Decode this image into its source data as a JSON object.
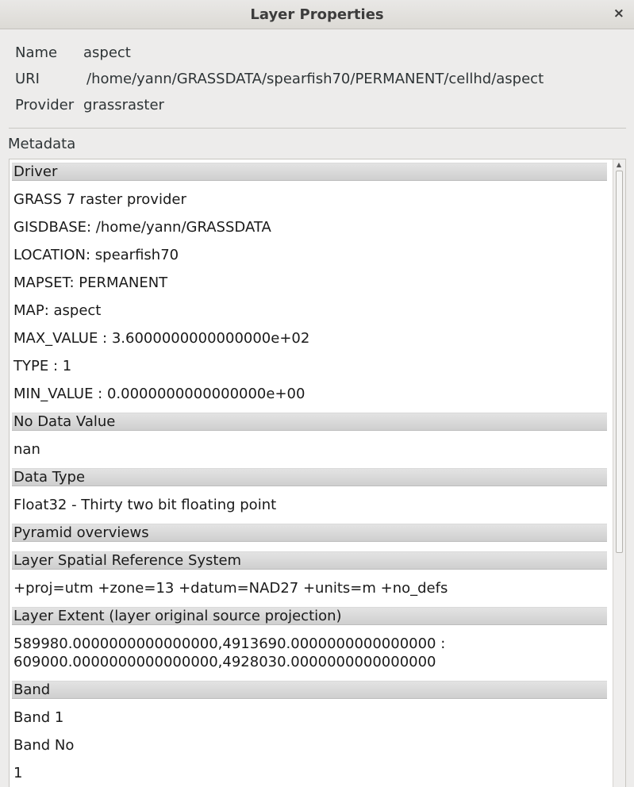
{
  "window": {
    "title": "Layer Properties",
    "close_glyph": "×"
  },
  "info": {
    "name_label": "Name",
    "name_value": "aspect",
    "uri_label": "URI",
    "uri_value": "/home/yann/GRASSDATA/spearfish70/PERMANENT/cellhd/aspect",
    "provider_label": "Provider",
    "provider_value": "grassraster"
  },
  "metadata": {
    "label": "Metadata",
    "rows": [
      {
        "kind": "header",
        "text": "Driver"
      },
      {
        "kind": "value",
        "text": "GRASS 7 raster provider"
      },
      {
        "kind": "value",
        "text": "GISDBASE: /home/yann/GRASSDATA"
      },
      {
        "kind": "value",
        "text": "LOCATION: spearfish70"
      },
      {
        "kind": "value",
        "text": "MAPSET: PERMANENT"
      },
      {
        "kind": "value",
        "text": "MAP: aspect"
      },
      {
        "kind": "value",
        "text": "MAX_VALUE : 3.6000000000000000e+02"
      },
      {
        "kind": "value",
        "text": "TYPE : 1"
      },
      {
        "kind": "value",
        "text": "MIN_VALUE : 0.0000000000000000e+00"
      },
      {
        "kind": "header",
        "text": "No Data Value"
      },
      {
        "kind": "value",
        "text": "nan"
      },
      {
        "kind": "header",
        "text": "Data Type"
      },
      {
        "kind": "value",
        "text": "Float32 - Thirty two bit floating point"
      },
      {
        "kind": "header",
        "text": "Pyramid overviews"
      },
      {
        "kind": "header",
        "text": "Layer Spatial Reference System"
      },
      {
        "kind": "value",
        "text": "+proj=utm +zone=13 +datum=NAD27 +units=m +no_defs"
      },
      {
        "kind": "header",
        "text": "Layer Extent (layer original source projection)"
      },
      {
        "kind": "multi",
        "lines": [
          "589980.0000000000000000,4913690.0000000000000000 :",
          "609000.0000000000000000,4928030.0000000000000000"
        ]
      },
      {
        "kind": "header",
        "text": "Band"
      },
      {
        "kind": "value",
        "text": "Band 1"
      },
      {
        "kind": "value",
        "text": "Band No"
      },
      {
        "kind": "value",
        "text": "1"
      }
    ]
  }
}
